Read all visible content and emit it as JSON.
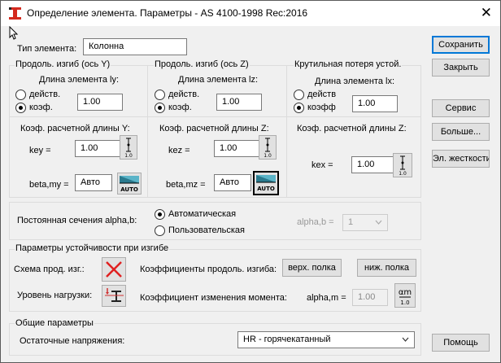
{
  "window": {
    "title": "Определение элемента. Параметры - AS 4100-1998 Rec:2016",
    "close": "✕"
  },
  "element": {
    "type_label": "Тип элемента:",
    "type_value": "Колонна"
  },
  "buttons": {
    "save": "Сохранить",
    "close": "Закрыть",
    "service": "Сервис",
    "more": "Больше...",
    "stiffness": "Эл. жесткости",
    "help": "Помощь"
  },
  "bending_y": {
    "title": "Продоль. изгиб (ось Y)",
    "length_label": "Длина элемента ly:",
    "radio_actual": "действ.",
    "radio_coef": "коэф.",
    "selected": "coef",
    "length_value": "1.00",
    "coef_title": "Коэф. расчетной длины Y:",
    "key_label": "key =",
    "key_value": "1.00",
    "beta_label": "beta,my =",
    "beta_value": "Авто"
  },
  "bending_z": {
    "title": "Продоль. изгиб (ось Z)",
    "length_label": "Длина элемента lz:",
    "radio_actual": "действ.",
    "radio_coef": "коэф.",
    "selected": "coef",
    "length_value": "1.00",
    "coef_title": "Коэф. расчетной длины Z:",
    "key_label": "kez =",
    "key_value": "1.00",
    "beta_label": "beta,mz =",
    "beta_value": "Авто"
  },
  "torsional": {
    "title": "Крутильная потеря устой.",
    "length_label": "Длина элемента lx:",
    "radio_actual": "действ",
    "radio_coef": "коэфф",
    "selected": "coef",
    "length_value": "1.00",
    "coef_title": "Коэф. расчетной длины  Z:",
    "key_label": "kex =",
    "key_value": "1.00"
  },
  "icons": {
    "length_glyph_value": "1.0",
    "auto_glyph_label": "AUTO",
    "alpha_m_glyph": "αm",
    "alpha_m_glyph_value": "1.0"
  },
  "alpha_b": {
    "label": "Постоянная сечения alpha,b:",
    "option_auto": "Автоматическая",
    "option_user": "Пользовательская",
    "selected": "auto",
    "value_label": "alpha,b =",
    "value": "1"
  },
  "lat_stability": {
    "title": "Параметры устойчивости при изгибе",
    "scheme_label": "Схема прод. изг.:",
    "load_label": "Уровень нагрузки:",
    "coef_label": "Коэффициенты продоль. изгиба:",
    "upper_flange": "верх. полка",
    "lower_flange": "ниж. полка",
    "moment_label": "Коэффициент изменения момента:",
    "alpha_m_label": "alpha,m =",
    "alpha_m_value": "1.00"
  },
  "general": {
    "title": "Общие параметры",
    "residual_label": "Остаточные напряжения:",
    "residual_value": "HR - горячекатанный"
  },
  "colors": {
    "accent": "#0078d7",
    "red_cross": "#e02020",
    "icon_teal": "#5ab4c8"
  }
}
